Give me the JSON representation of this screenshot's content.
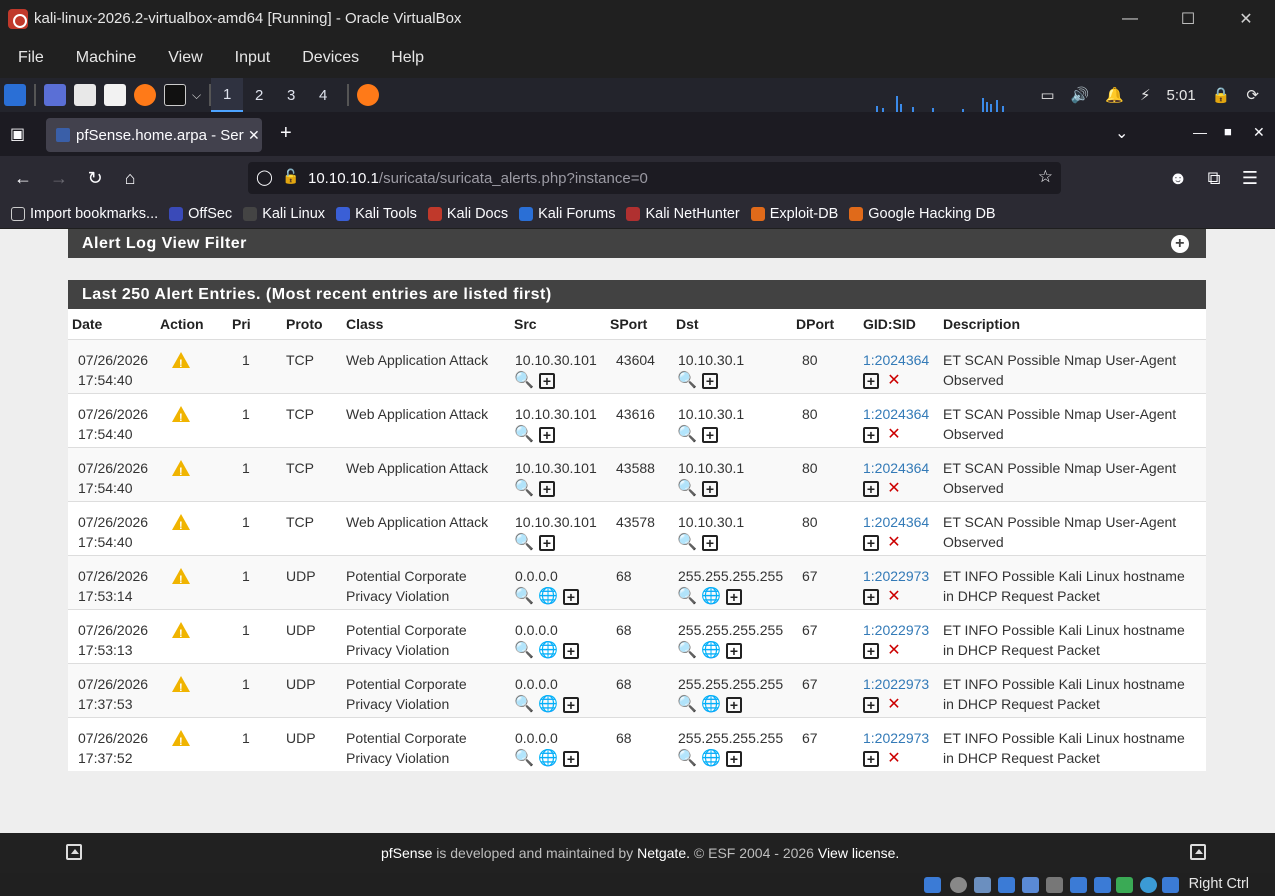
{
  "vbox": {
    "title": "kali-linux-2026.2-virtualbox-amd64 [Running] - Oracle VirtualBox",
    "menu": [
      "File",
      "Machine",
      "View",
      "Input",
      "Devices",
      "Help"
    ],
    "host_key": "Right Ctrl"
  },
  "kali_panel": {
    "workspaces": [
      "1",
      "2",
      "3",
      "4"
    ],
    "clock": "5:01"
  },
  "firefox": {
    "tab_title": "pfSense.home.arpa - Serv",
    "url_host": "10.10.10.1",
    "url_path": "/suricata/suricata_alerts.php?instance=0",
    "bookmarks": [
      "Import bookmarks...",
      "OffSec",
      "Kali Linux",
      "Kali Tools",
      "Kali Docs",
      "Kali Forums",
      "Kali NetHunter",
      "Exploit-DB",
      "Google Hacking DB"
    ]
  },
  "page": {
    "filter_title": "Alert Log View Filter",
    "alerts_title": "Last 250 Alert Entries. (Most recent entries are listed first)",
    "columns": [
      "Date",
      "Action",
      "Pri",
      "Proto",
      "Class",
      "Src",
      "SPort",
      "Dst",
      "DPort",
      "GID:SID",
      "Description"
    ],
    "rows": [
      {
        "date": "07/26/2026",
        "time": "17:54:40",
        "pri": "1",
        "proto": "TCP",
        "class1": "Web Application Attack",
        "class2": "",
        "src": "10.10.30.101",
        "sport": "43604",
        "dst": "10.10.30.1",
        "dport": "80",
        "sid": "1:2024364",
        "desc1": "ET SCAN Possible Nmap User-Agent",
        "desc2": "Observed",
        "geo": false
      },
      {
        "date": "07/26/2026",
        "time": "17:54:40",
        "pri": "1",
        "proto": "TCP",
        "class1": "Web Application Attack",
        "class2": "",
        "src": "10.10.30.101",
        "sport": "43616",
        "dst": "10.10.30.1",
        "dport": "80",
        "sid": "1:2024364",
        "desc1": "ET SCAN Possible Nmap User-Agent",
        "desc2": "Observed",
        "geo": false
      },
      {
        "date": "07/26/2026",
        "time": "17:54:40",
        "pri": "1",
        "proto": "TCP",
        "class1": "Web Application Attack",
        "class2": "",
        "src": "10.10.30.101",
        "sport": "43588",
        "dst": "10.10.30.1",
        "dport": "80",
        "sid": "1:2024364",
        "desc1": "ET SCAN Possible Nmap User-Agent",
        "desc2": "Observed",
        "geo": false
      },
      {
        "date": "07/26/2026",
        "time": "17:54:40",
        "pri": "1",
        "proto": "TCP",
        "class1": "Web Application Attack",
        "class2": "",
        "src": "10.10.30.101",
        "sport": "43578",
        "dst": "10.10.30.1",
        "dport": "80",
        "sid": "1:2024364",
        "desc1": "ET SCAN Possible Nmap User-Agent",
        "desc2": "Observed",
        "geo": false
      },
      {
        "date": "07/26/2026",
        "time": "17:53:14",
        "pri": "1",
        "proto": "UDP",
        "class1": "Potential Corporate",
        "class2": "Privacy Violation",
        "src": "0.0.0.0",
        "sport": "68",
        "dst": "255.255.255.255",
        "dport": "67",
        "sid": "1:2022973",
        "desc1": "ET INFO Possible Kali Linux hostname",
        "desc2": "in DHCP Request Packet",
        "geo": true
      },
      {
        "date": "07/26/2026",
        "time": "17:53:13",
        "pri": "1",
        "proto": "UDP",
        "class1": "Potential Corporate",
        "class2": "Privacy Violation",
        "src": "0.0.0.0",
        "sport": "68",
        "dst": "255.255.255.255",
        "dport": "67",
        "sid": "1:2022973",
        "desc1": "ET INFO Possible Kali Linux hostname",
        "desc2": "in DHCP Request Packet",
        "geo": true
      },
      {
        "date": "07/26/2026",
        "time": "17:37:53",
        "pri": "1",
        "proto": "UDP",
        "class1": "Potential Corporate",
        "class2": "Privacy Violation",
        "src": "0.0.0.0",
        "sport": "68",
        "dst": "255.255.255.255",
        "dport": "67",
        "sid": "1:2022973",
        "desc1": "ET INFO Possible Kali Linux hostname",
        "desc2": "in DHCP Request Packet",
        "geo": true
      },
      {
        "date": "07/26/2026",
        "time": "17:37:52",
        "pri": "1",
        "proto": "UDP",
        "class1": "Potential Corporate",
        "class2": "Privacy Violation",
        "src": "0.0.0.0",
        "sport": "68",
        "dst": "255.255.255.255",
        "dport": "67",
        "sid": "1:2022973",
        "desc1": "ET INFO Possible Kali Linux hostname",
        "desc2": "in DHCP Request Packet",
        "geo": true
      }
    ]
  },
  "footer": {
    "brand": "pfSense",
    "text1": " is developed and maintained by ",
    "company": "Netgate.",
    "text2": " © ESF 2004 - 2026 ",
    "license": "View license."
  },
  "colors": {
    "warning": "#f0b400",
    "link": "#337ab7",
    "panel_header": "#424242",
    "remove": "#cc0000"
  }
}
